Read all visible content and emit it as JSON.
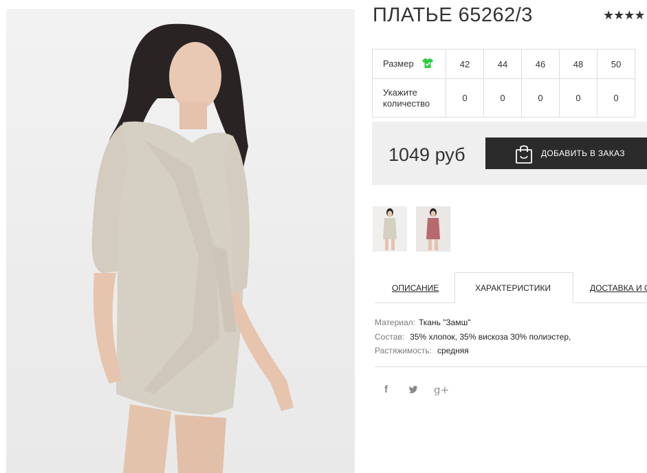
{
  "product": {
    "title": "ПЛАТЬЕ 65262/3",
    "rating_stars": "★★★★",
    "price": "1049 руб",
    "add_to_order_label": "ДОБАВИТЬ В ЗАКАЗ"
  },
  "size_table": {
    "size_label": "Размер",
    "quantity_label": "Укажите количество",
    "sizes": [
      "42",
      "44",
      "46",
      "48",
      "50"
    ],
    "quantities": [
      "0",
      "0",
      "0",
      "0",
      "0"
    ]
  },
  "tabs": {
    "description": "ОПИСАНИЕ",
    "characteristics": "ХАРАКТЕРИСТИКИ",
    "delivery": "ДОСТАВКА И ОПЛАТА"
  },
  "specs": [
    {
      "key": "Материал:",
      "value": "Ткань \"Замш\""
    },
    {
      "key": "Состав:",
      "value": "35% хлопок, 35% вискоза 30% полиэстер,"
    },
    {
      "key": "Растяжимость:",
      "value": "средняя"
    }
  ],
  "social": {
    "facebook": "f",
    "twitter": "t",
    "google_plus": "g+"
  },
  "colors": {
    "accent_dark": "#2b2b2b",
    "panel_bg": "#efefef",
    "tshirt_icon": "#2ecc40",
    "dress_beige": "#d6cfc3",
    "dress_pink": "#b66a6e"
  },
  "icons": [
    "tshirt-icon",
    "shopping-bag-icon",
    "facebook-icon",
    "twitter-icon",
    "google-plus-icon"
  ]
}
